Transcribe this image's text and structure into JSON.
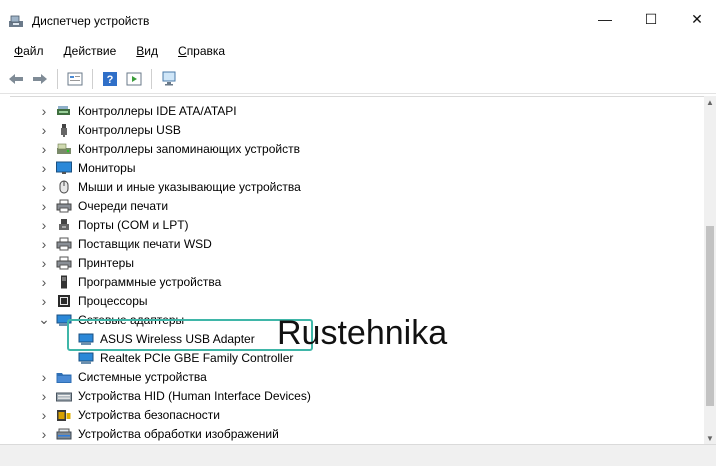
{
  "window": {
    "title": "Диспетчер устройств",
    "minimize": "—",
    "maximize": "☐",
    "close": "✕"
  },
  "menu": {
    "file": {
      "u": "Ф",
      "rest": "айл"
    },
    "action": {
      "u": "Д",
      "rest": "ействие"
    },
    "view": {
      "u": "В",
      "rest": "ид"
    },
    "help": {
      "u": "С",
      "rest": "правка"
    }
  },
  "tree": {
    "items": [
      {
        "label": "Контроллеры IDE ATA/ATAPI",
        "icon": "ide-controller-icon"
      },
      {
        "label": "Контроллеры USB",
        "icon": "usb-icon"
      },
      {
        "label": "Контроллеры запоминающих устройств",
        "icon": "storage-icon"
      },
      {
        "label": "Мониторы",
        "icon": "monitor-icon"
      },
      {
        "label": "Мыши и иные указывающие устройства",
        "icon": "mouse-icon"
      },
      {
        "label": "Очереди печати",
        "icon": "printer-icon"
      },
      {
        "label": "Порты (COM и LPT)",
        "icon": "port-icon"
      },
      {
        "label": "Поставщик печати WSD",
        "icon": "printer-icon"
      },
      {
        "label": "Принтеры",
        "icon": "printer-icon"
      },
      {
        "label": "Программные устройства",
        "icon": "software-device-icon"
      },
      {
        "label": "Процессоры",
        "icon": "cpu-icon"
      },
      {
        "label": "Сетевые адаптеры",
        "icon": "network-adapter-icon",
        "expanded": true
      },
      {
        "label": "ASUS Wireless USB Adapter",
        "icon": "network-adapter-icon",
        "child": true
      },
      {
        "label": "Realtek PCIe GBE Family Controller",
        "icon": "network-adapter-icon",
        "child": true
      },
      {
        "label": "Системные устройства",
        "icon": "system-folder-icon"
      },
      {
        "label": "Устройства HID (Human Interface Devices)",
        "icon": "hid-icon"
      },
      {
        "label": "Устройства безопасности",
        "icon": "security-device-icon"
      },
      {
        "label": "Устройства обработки изображений",
        "icon": "imaging-device-icon"
      }
    ]
  },
  "watermark": "Rustehnika",
  "colors": {
    "highlight": "#3fb6a8",
    "monitor_blue": "#2b88d8",
    "folder_blue": "#2f6fb5"
  }
}
